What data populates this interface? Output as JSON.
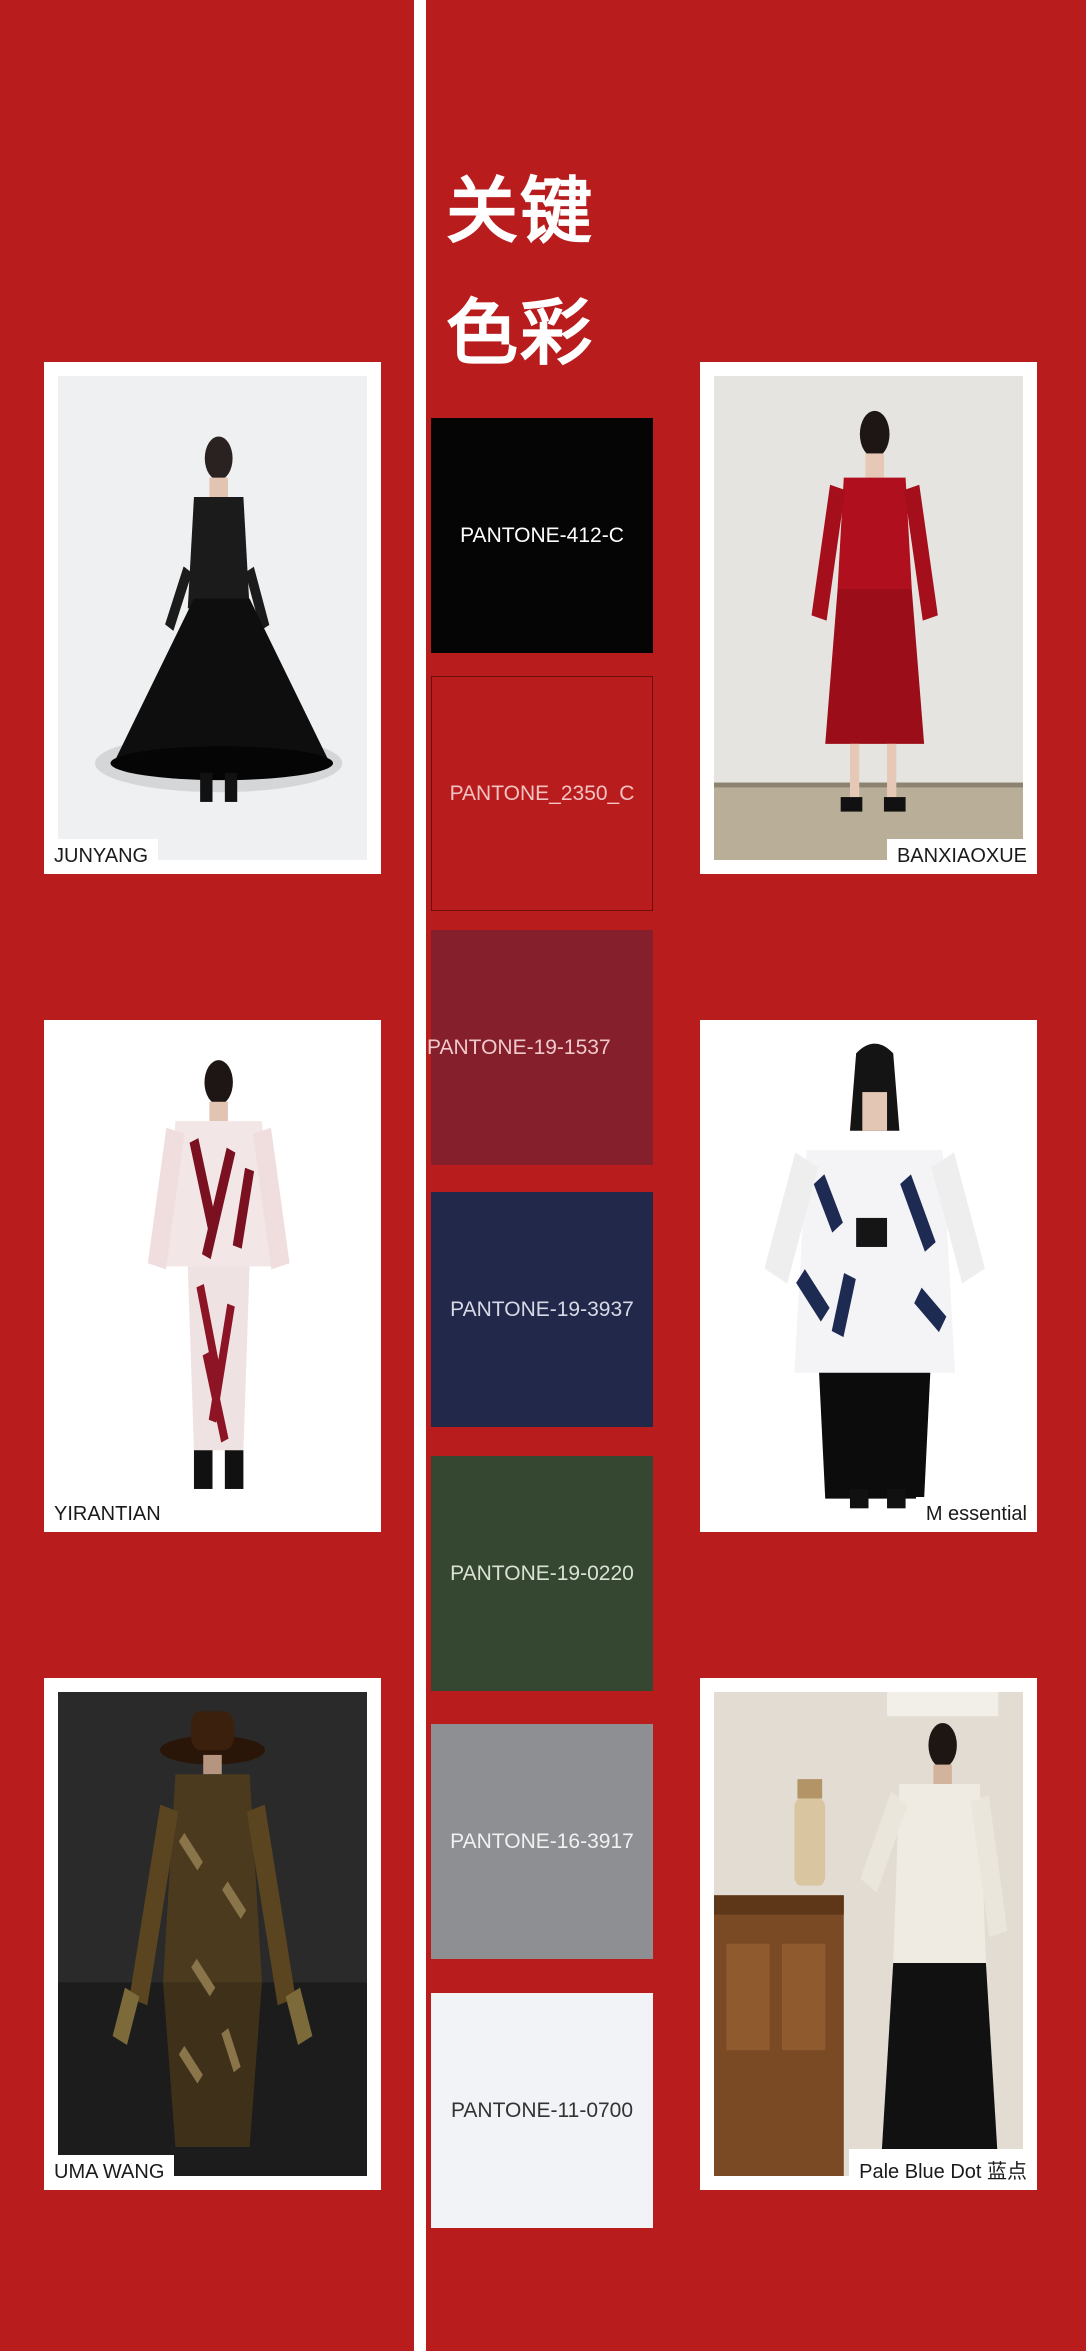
{
  "title": {
    "line1": "关键",
    "line2": "色彩"
  },
  "swatches": [
    {
      "label": "PANTONE-412-C",
      "color": "#050505",
      "text_color": "#ffffff"
    },
    {
      "label": "PANTONE_2350_C",
      "color": "#b81c1c",
      "text_color": "#f3c2c2"
    },
    {
      "label": "PANTONE-19-1537",
      "color": "#841f2b",
      "text_color": "#f1c9cc"
    },
    {
      "label": "PANTONE-19-3937",
      "color": "#222849",
      "text_color": "#d7d9e6"
    },
    {
      "label": "PANTONE-19-0220",
      "color": "#354730",
      "text_color": "#d9e2d4"
    },
    {
      "label": "PANTONE-16-3917",
      "color": "#8d8f93",
      "text_color": "#f1f1f2"
    },
    {
      "label": "PANTONE-11-0700",
      "color": "#f1f3f7",
      "text_color": "#333333"
    }
  ],
  "looks": [
    {
      "brand": "JUNYANG"
    },
    {
      "brand": "BANXIAOXUE"
    },
    {
      "brand": "YIRANTIAN"
    },
    {
      "brand": "M essential"
    },
    {
      "brand": "UMA WANG"
    },
    {
      "brand": "Pale Blue Dot 蓝点"
    }
  ]
}
